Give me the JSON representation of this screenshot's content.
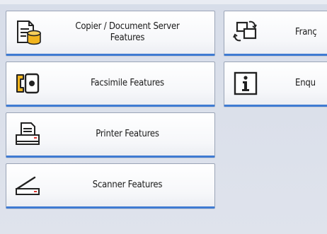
{
  "buttons": {
    "copier": {
      "label": "Copier / Document Server\nFeatures",
      "icon": "copier-document-server-icon"
    },
    "facsimile": {
      "label": "Facsimile Features",
      "icon": "facsimile-icon"
    },
    "printer": {
      "label": "Printer Features",
      "icon": "printer-icon"
    },
    "scanner": {
      "label": "Scanner Features",
      "icon": "scanner-icon"
    },
    "language": {
      "label": "Franç",
      "icon": "change-language-icon"
    },
    "enquiry": {
      "label": "Enqu",
      "icon": "information-icon"
    }
  },
  "colors": {
    "accent": "#3f7bd2",
    "icon_yellow": "#f2b51e",
    "background": "#dfe3ec"
  }
}
